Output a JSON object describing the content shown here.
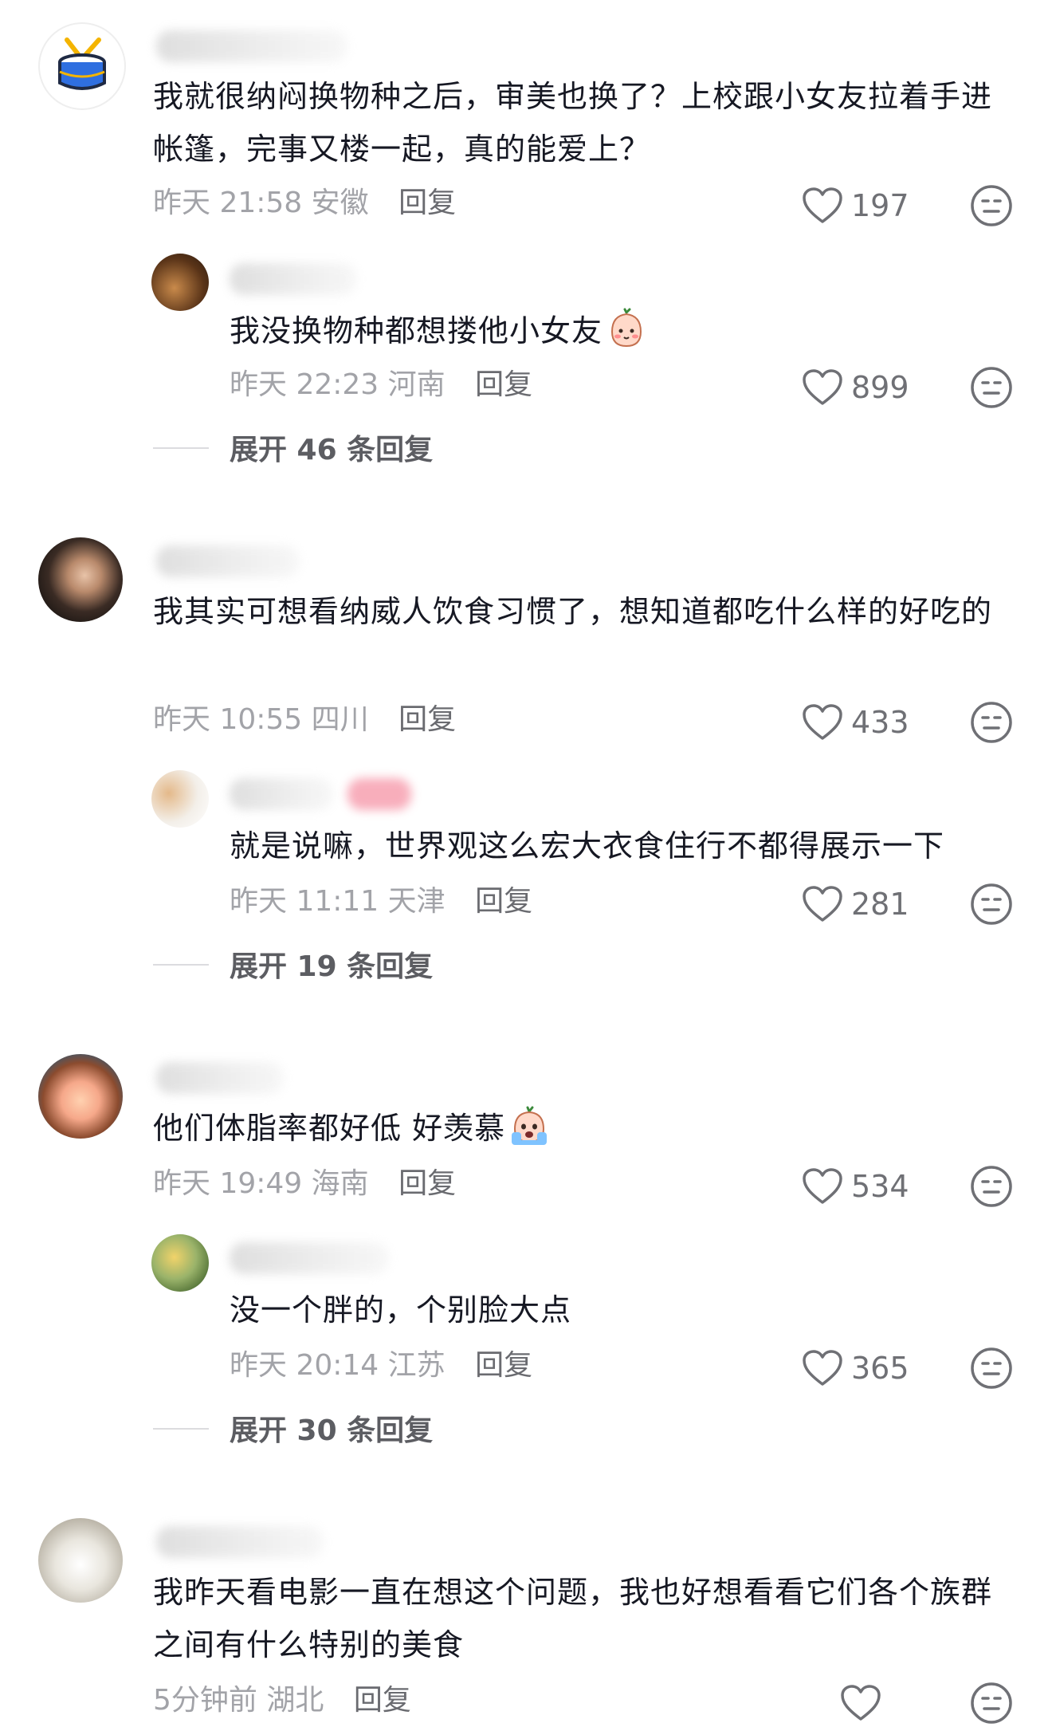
{
  "comments": [
    {
      "text": "我就很纳闷换物种之后，审美也换了？上校跟小女友拉着手进帐篷，完事又楼一起，真的能爱上？",
      "time": "昨天 21:58",
      "location": "安徽",
      "reply_label": "回复",
      "likes": "197",
      "avatar_icon": "drum-icon",
      "reply": {
        "text": "我没换物种都想搂他小女友",
        "emoji": "shy-face-emoji",
        "time": "昨天 22:23",
        "location": "河南",
        "reply_label": "回复",
        "likes": "899"
      },
      "expand": "展开 46 条回复"
    },
    {
      "text": "我其实可想看纳威人饮食习惯了，想知道都吃什么样的好吃的",
      "time": "昨天 10:55",
      "location": "四川",
      "reply_label": "回复",
      "likes": "433",
      "reply": {
        "text": "就是说嘛，世界观这么宏大衣食住行不都得展示一下",
        "time": "昨天 11:11",
        "location": "天津",
        "reply_label": "回复",
        "likes": "281"
      },
      "expand": "展开 19 条回复"
    },
    {
      "text": "他们体脂率都好低 好羡慕",
      "emoji": "crying-face-emoji",
      "time": "昨天 19:49",
      "location": "海南",
      "reply_label": "回复",
      "likes": "534",
      "reply": {
        "text": "没一个胖的，个别脸大点",
        "time": "昨天 20:14",
        "location": "江苏",
        "reply_label": "回复",
        "likes": "365"
      },
      "expand": "展开 30 条回复"
    },
    {
      "text": "我昨天看电影一直在想这个问题，我也好想看看它们各个族群之间有什么特别的美食",
      "time": "5分钟前",
      "location": "湖北",
      "reply_label": "回复",
      "likes": ""
    }
  ],
  "colors": {
    "text": "#161823",
    "meta": "#a2a3a8",
    "icon": "#6f7075"
  }
}
